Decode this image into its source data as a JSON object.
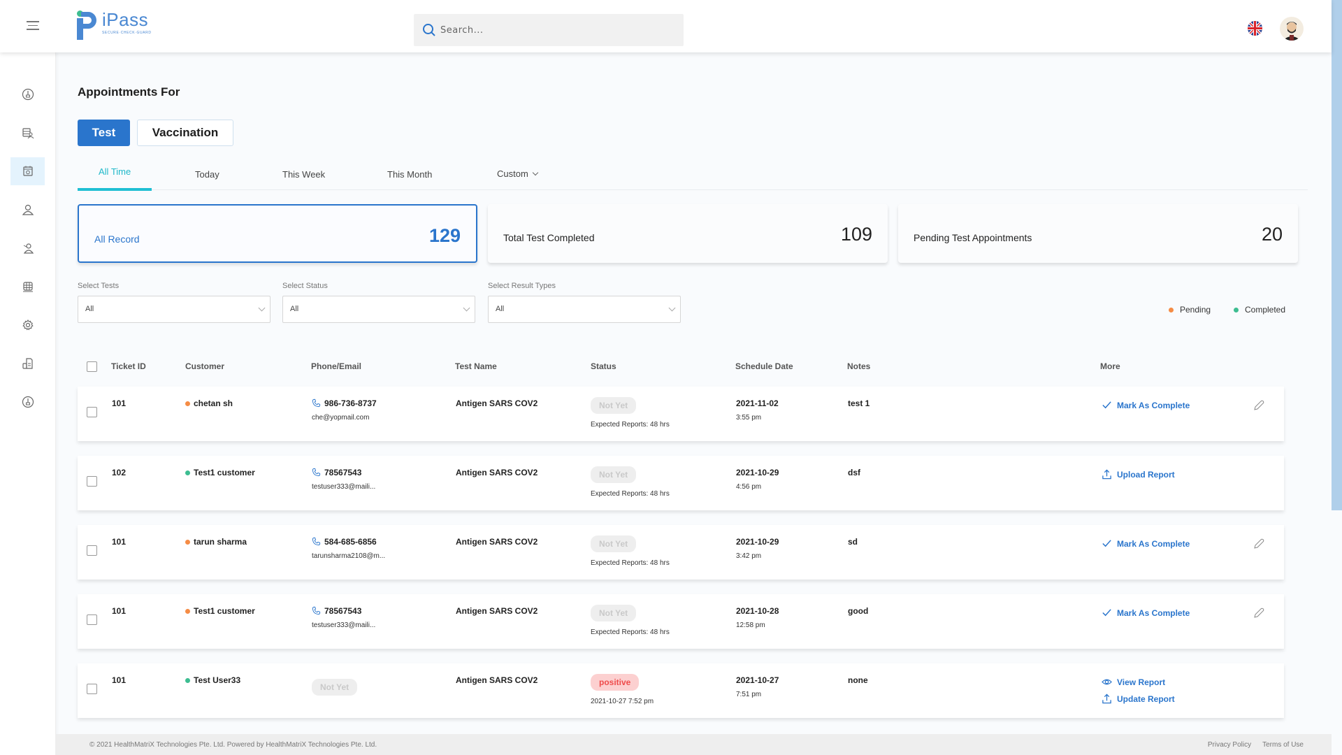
{
  "header": {
    "app_name": "iPass",
    "tagline": "SECURE·CHECK·GUARD",
    "search_placeholder": "Search...",
    "language": "English (UK)"
  },
  "sidebar": {
    "items": [
      {
        "icon": "dashboard-icon",
        "active": false
      },
      {
        "icon": "database-user-icon",
        "active": false
      },
      {
        "icon": "calendar-check-icon",
        "active": true
      },
      {
        "icon": "user-icon",
        "active": false
      },
      {
        "icon": "user-search-icon",
        "active": false
      },
      {
        "icon": "globe-grid-icon",
        "active": false
      },
      {
        "icon": "gear-icon",
        "active": false
      },
      {
        "icon": "document-hand-icon",
        "active": false
      },
      {
        "icon": "dashboard-icon",
        "active": false
      }
    ]
  },
  "main": {
    "title": "Appointments For",
    "segments": {
      "test": "Test",
      "vaccination": "Vaccination",
      "selected": "Test"
    },
    "tabs": [
      {
        "label": "All Time",
        "active": true
      },
      {
        "label": "Today",
        "active": false
      },
      {
        "label": "This Week",
        "active": false
      },
      {
        "label": "This Month",
        "active": false
      },
      {
        "label": "Custom",
        "active": false
      }
    ],
    "stats": [
      {
        "label": "All Record",
        "value": "129",
        "active": true
      },
      {
        "label": "Total Test Completed",
        "value": "109",
        "active": false
      },
      {
        "label": "Pending Test Appointments",
        "value": "20",
        "active": false
      }
    ],
    "filters": [
      {
        "label": "Select Tests",
        "value": "All"
      },
      {
        "label": "Select Status",
        "value": "All"
      },
      {
        "label": "Select Result Types",
        "value": "All"
      }
    ],
    "legend": [
      {
        "label": "Pending",
        "color": "#f58c45"
      },
      {
        "label": "Completed",
        "color": "#3dbd91"
      }
    ],
    "table": {
      "columns": [
        "Ticket ID",
        "Customer",
        "Phone/Email",
        "Test Name",
        "Status",
        "Schedule Date",
        "Notes",
        "More"
      ],
      "rows": [
        {
          "ticket": "101",
          "customer": "chetan sh",
          "state": "pending",
          "phone": "986-736-8737",
          "email": "che@yopmail.com",
          "test": "Antigen SARS COV2",
          "status": "Not Yet",
          "status_type": "grey",
          "status_sub": "Expected Reports: 48 hrs",
          "date": "2021-11-02",
          "time": "3:55 pm",
          "notes": "test 1",
          "actions": [
            "Mark As Complete"
          ],
          "editable": true
        },
        {
          "ticket": "102",
          "customer": "Test1 customer",
          "state": "completed",
          "phone": "78567543",
          "email": "testuser333@maili...",
          "test": "Antigen SARS COV2",
          "status": "Not Yet",
          "status_type": "grey",
          "status_sub": "Expected Reports: 48 hrs",
          "date": "2021-10-29",
          "time": "4:56 pm",
          "notes": "dsf",
          "actions": [
            "Upload Report"
          ],
          "editable": false
        },
        {
          "ticket": "101",
          "customer": "tarun sharma",
          "state": "pending",
          "phone": "584-685-6856",
          "email": "tarunsharma2108@m...",
          "test": "Antigen SARS COV2",
          "status": "Not Yet",
          "status_type": "grey",
          "status_sub": "Expected Reports: 48 hrs",
          "date": "2021-10-29",
          "time": "3:42 pm",
          "notes": "sd",
          "actions": [
            "Mark As Complete"
          ],
          "editable": true
        },
        {
          "ticket": "101",
          "customer": "Test1 customer",
          "state": "pending",
          "phone": "78567543",
          "email": "testuser333@maili...",
          "test": "Antigen SARS COV2",
          "status": "Not Yet",
          "status_type": "grey",
          "status_sub": "Expected Reports: 48 hrs",
          "date": "2021-10-28",
          "time": "12:58 pm",
          "notes": "good",
          "actions": [
            "Mark As Complete"
          ],
          "editable": true
        },
        {
          "ticket": "101",
          "customer": "Test User33",
          "state": "completed",
          "contact_pill": "Not Yet",
          "test": "Antigen SARS COV2",
          "status": "positive",
          "status_type": "red",
          "status_sub": "2021-10-27 7:52 pm",
          "date": "2021-10-27",
          "time": "7:51 pm",
          "notes": "none",
          "actions": [
            "View Report",
            "Update Report"
          ],
          "editable": false
        }
      ]
    }
  },
  "footer": {
    "copyright": "© 2021 HealthMatriX Technologies Pte. Ltd. Powered by HealthMatriX Technologies Pte. Ltd.",
    "links": [
      "Privacy Policy",
      "Terms of Use"
    ]
  },
  "colors": {
    "accent": "#2a75cc",
    "tab_active": "#1fbfd3",
    "pending": "#f58c45",
    "completed": "#3dbd91",
    "positive": "#ef4c4c"
  }
}
